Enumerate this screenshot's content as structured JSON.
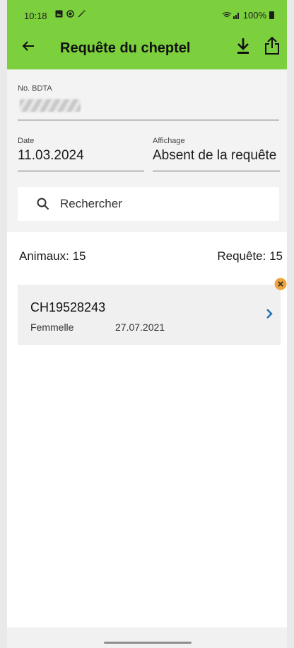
{
  "status": {
    "time": "10:18",
    "battery": "100%"
  },
  "toolbar": {
    "title": "Requête du cheptel"
  },
  "filters": {
    "bdta_label": "No. BDTA",
    "date_label": "Date",
    "date_value": "11.03.2024",
    "display_label": "Affichage",
    "display_value": "Absent de la requête"
  },
  "search": {
    "placeholder": "Rechercher"
  },
  "counts": {
    "animals": "Animaux: 15",
    "query": "Requête: 15"
  },
  "animals": [
    {
      "id": "CH19528243",
      "sex": "Femmelle",
      "date": "27.07.2021"
    }
  ],
  "colors": {
    "appbar": "#7ccf3d",
    "badge": "#f0a33a",
    "chevron": "#1f6fb3"
  }
}
